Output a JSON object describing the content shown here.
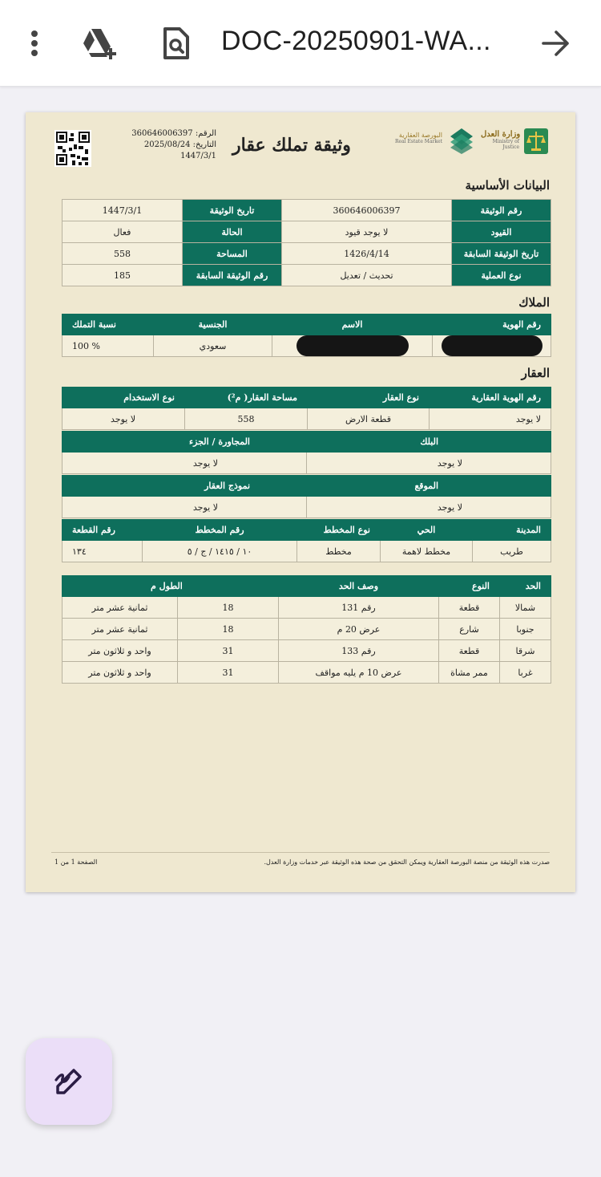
{
  "app_bar": {
    "file_title": "DOC-20250901-WA...",
    "icons": [
      "more-vert-icon",
      "drive-add-icon",
      "document-search-icon",
      "arrow-forward-icon"
    ]
  },
  "document": {
    "header": {
      "doc_number_label": "الرقم:",
      "doc_number": "360646006397",
      "date_label": "التاريخ:",
      "date_gregorian": "2025/08/24",
      "date_hijri": "1447/3/1",
      "title": "وثيقة تملك عقار",
      "logo_market_ar": "البورصة العقارية",
      "logo_market_en": "Real Estate Market",
      "logo_moj_ar": "وزارة العدل",
      "logo_moj_en": "Ministry of Justice"
    },
    "basic_info": {
      "section_title": "البيانات الأساسية",
      "rows": [
        {
          "label1": "رقم الوثيقة",
          "value1": "360646006397",
          "label2": "تاريخ الوثيقة",
          "value2": "1447/3/1"
        },
        {
          "label1": "القيود",
          "value1": "لا يوجد قيود",
          "label2": "الحالة",
          "value2": "فعال"
        },
        {
          "label1": "تاريخ الوثيقة السابقة",
          "value1": "1426/4/14",
          "label2": "المساحة",
          "value2": "558"
        },
        {
          "label1": "نوع العملية",
          "value1": "تحديث / تعديل",
          "label2": "رقم الوثيقة السابقة",
          "value2": "185"
        }
      ]
    },
    "owners": {
      "section_title": "الملاك",
      "headers": [
        "رقم الهوية",
        "الاسم",
        "الجنسية",
        "نسبة التملك"
      ],
      "row": {
        "nationality": "سعودي",
        "share": "% 100"
      }
    },
    "property": {
      "section_title": "العقار",
      "h1": [
        "رقم الهوية العقارية",
        "نوع العقار",
        "مساحة العقار( م²)",
        "نوع الاستخدام"
      ],
      "v1": [
        "لا يوجد",
        "قطعة الارض",
        "558",
        "لا يوجد"
      ],
      "h2": [
        "البلك",
        "المجاورة / الجزء"
      ],
      "v2": [
        "لا يوجد",
        "لا يوجد"
      ],
      "h3": [
        "الموقع",
        "نموذج العقار"
      ],
      "v3": [
        "لا يوجد",
        "لا يوجد"
      ],
      "h4": [
        "المدينة",
        "الحي",
        "نوع المخطط",
        "رقم المخطط",
        "رقم القطعة"
      ],
      "v4": [
        "طريب",
        "مخطط لاهمة",
        "مخطط",
        "١٠ / ١٤١٥ / ج / ٥",
        "١٣٤"
      ]
    },
    "boundaries": {
      "headers": [
        "الحد",
        "النوع",
        "وصف الحد",
        "الطول م"
      ],
      "rows": [
        {
          "side": "شمالا",
          "type": "قطعة",
          "desc": "رقم 131",
          "num": "18",
          "text": "ثمانية عشر متر"
        },
        {
          "side": "جنوبا",
          "type": "شارع",
          "desc": "عرض 20 م",
          "num": "18",
          "text": "ثمانية عشر متر"
        },
        {
          "side": "شرقا",
          "type": "قطعة",
          "desc": "رقم 133",
          "num": "31",
          "text": "واحد و ثلاثون متر"
        },
        {
          "side": "غربا",
          "type": "ممر مشاة",
          "desc": "عرض 10 م يليه مواقف",
          "num": "31",
          "text": "واحد و ثلاثون متر"
        }
      ]
    },
    "footer": {
      "note": "صدرت هذه الوثيقة من منصة البورصة العقارية ويمكن التحقق من صحة هذه الوثيقة عبر خدمات وزارة العدل.",
      "page": "الصفحة 1 من 1"
    }
  },
  "fab": {
    "icon": "draw-edit-icon"
  }
}
